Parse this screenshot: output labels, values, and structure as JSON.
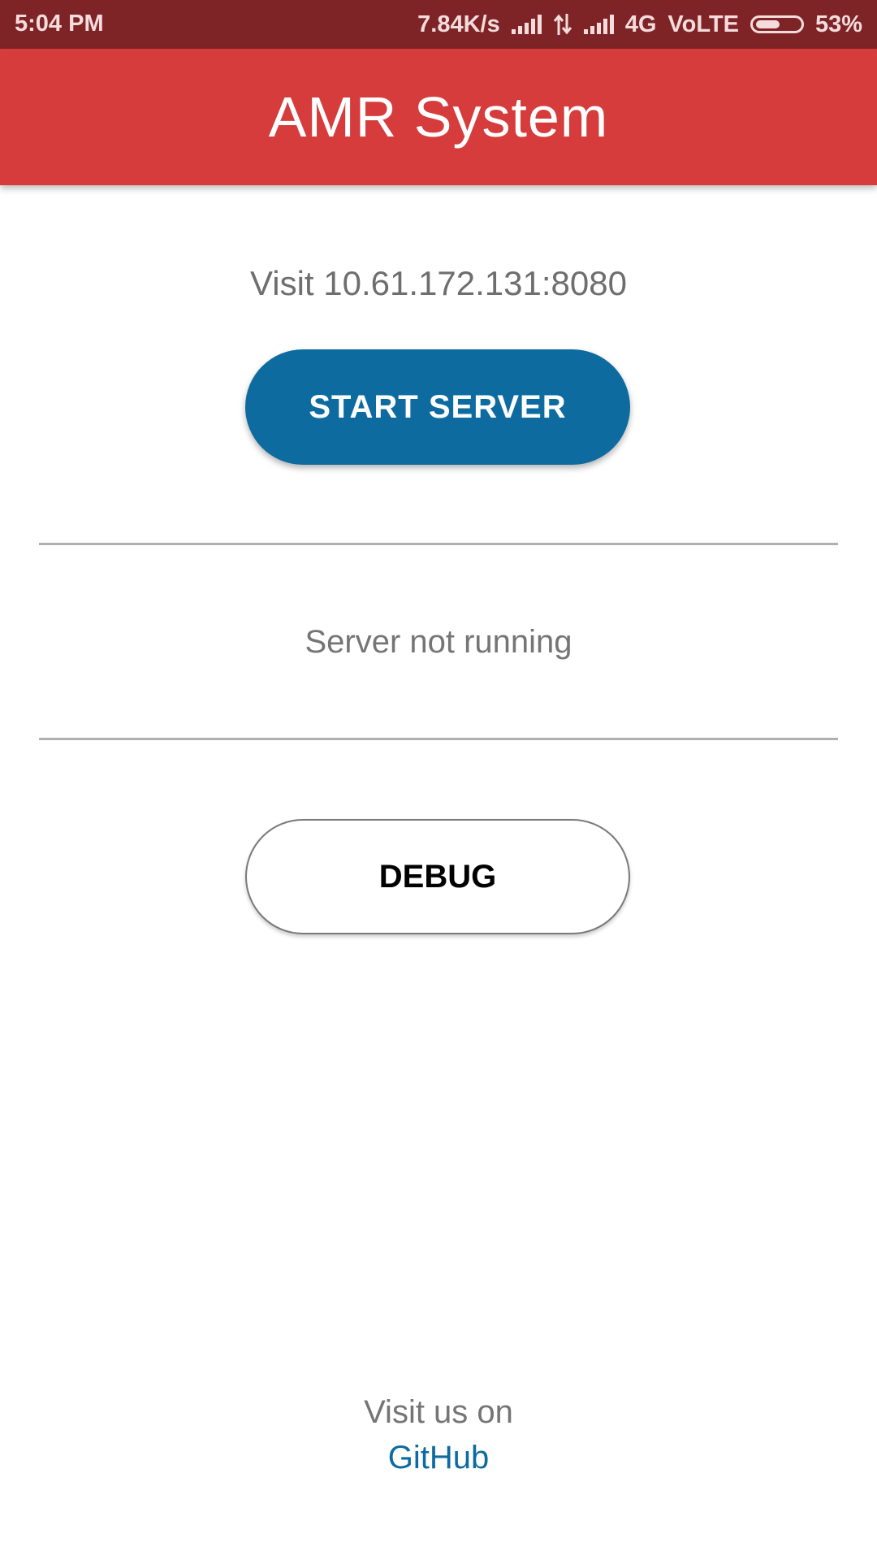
{
  "status_bar": {
    "time": "5:04 PM",
    "network_speed": "7.84K/s",
    "network_type": "4G",
    "volte": "VoLTE",
    "battery": "53%",
    "battery_level": 0.53
  },
  "app_bar": {
    "title": "AMR System",
    "color": "#d63c3c"
  },
  "main": {
    "visit_address": "Visit 10.61.172.131:8080",
    "start_button_label": "START SERVER",
    "start_button_color": "#0e6ba0",
    "server_status": "Server not running",
    "debug_button_label": "DEBUG"
  },
  "footer": {
    "text": "Visit us on",
    "link_label": "GitHub",
    "link_color": "#0e6ba0"
  }
}
